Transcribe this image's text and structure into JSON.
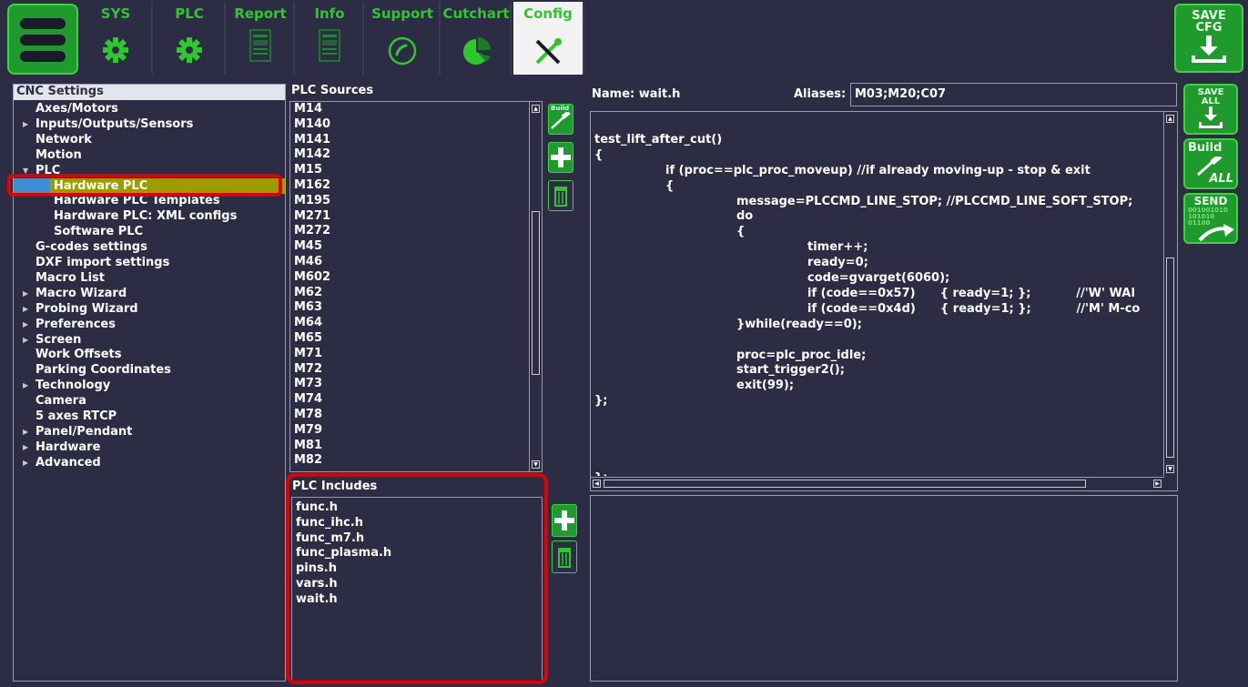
{
  "toolbar": {
    "tabs": [
      {
        "label": "SYS",
        "icon": "gear-icon"
      },
      {
        "label": "PLC",
        "icon": "gear-icon"
      },
      {
        "label": "Report",
        "icon": "report-icon"
      },
      {
        "label": "Info",
        "icon": "info-icon"
      },
      {
        "label": "Support",
        "icon": "phone-icon"
      },
      {
        "label": "Cutchart",
        "icon": "pie-chart-icon"
      },
      {
        "label": "Config",
        "icon": "tools-icon"
      }
    ],
    "active_tab": "Config",
    "save_cfg": [
      "SAVE",
      "CFG"
    ]
  },
  "right_buttons": {
    "save_all": [
      "SAVE",
      "ALL"
    ],
    "build_all": [
      "Build",
      "ALL"
    ],
    "send": "SEND",
    "send_digits": [
      "001001010",
      "101010",
      "01100"
    ]
  },
  "settings_tree": {
    "header": "CNC Settings",
    "items": [
      {
        "label": "Axes/Motors",
        "indent": 1,
        "arrow": ""
      },
      {
        "label": "Inputs/Outputs/Sensors",
        "indent": 1,
        "arrow": "right"
      },
      {
        "label": "Network",
        "indent": 1,
        "arrow": ""
      },
      {
        "label": "Motion",
        "indent": 1,
        "arrow": ""
      },
      {
        "label": "PLC",
        "indent": 1,
        "arrow": "down"
      },
      {
        "label": "Hardware PLC",
        "indent": 2,
        "arrow": "",
        "selected": true
      },
      {
        "label": "Hardware PLC Templates",
        "indent": 2,
        "arrow": ""
      },
      {
        "label": "Hardware PLC: XML configs",
        "indent": 2,
        "arrow": ""
      },
      {
        "label": "Software PLC",
        "indent": 2,
        "arrow": ""
      },
      {
        "label": "G-codes settings",
        "indent": 1,
        "arrow": ""
      },
      {
        "label": "DXF import settings",
        "indent": 1,
        "arrow": ""
      },
      {
        "label": "Macro List",
        "indent": 1,
        "arrow": ""
      },
      {
        "label": "Macro Wizard",
        "indent": 1,
        "arrow": "right"
      },
      {
        "label": "Probing Wizard",
        "indent": 1,
        "arrow": "right"
      },
      {
        "label": "Preferences",
        "indent": 1,
        "arrow": "right"
      },
      {
        "label": "Screen",
        "indent": 1,
        "arrow": "right"
      },
      {
        "label": "Work Offsets",
        "indent": 1,
        "arrow": ""
      },
      {
        "label": "Parking Coordinates",
        "indent": 1,
        "arrow": ""
      },
      {
        "label": "Technology",
        "indent": 1,
        "arrow": "right"
      },
      {
        "label": "Camera",
        "indent": 1,
        "arrow": ""
      },
      {
        "label": "5 axes RTCP",
        "indent": 1,
        "arrow": ""
      },
      {
        "label": "Panel/Pendant",
        "indent": 1,
        "arrow": "right"
      },
      {
        "label": "Hardware",
        "indent": 1,
        "arrow": "right"
      },
      {
        "label": "Advanced",
        "indent": 1,
        "arrow": "right"
      }
    ]
  },
  "plc_sources": {
    "header": "PLC Sources",
    "build_label": "Build",
    "items": [
      "M14",
      "M140",
      "M141",
      "M142",
      "M15",
      "M162",
      "M195",
      "M271",
      "M272",
      "M45",
      "M46",
      "M602",
      "M62",
      "M63",
      "M64",
      "M65",
      "M71",
      "M72",
      "M73",
      "M74",
      "M78",
      "M79",
      "M81",
      "M82"
    ]
  },
  "plc_includes": {
    "header": "PLC Includes",
    "items": [
      "func.h",
      "func_ihc.h",
      "func_m7.h",
      "func_plasma.h",
      "pins.h",
      "vars.h",
      "wait.h"
    ]
  },
  "editor": {
    "name_label": "Name: wait.h",
    "aliases_label": "Aliases:",
    "aliases_value": "M03;M20;C07",
    "lines": [
      {
        "t": "",
        "i": 0
      },
      {
        "t": "test_lift_after_cut()",
        "i": 0
      },
      {
        "t": "{",
        "i": 0
      },
      {
        "t": "if (proc==plc_proc_moveup) //if already moving-up - stop & exit",
        "i": 1
      },
      {
        "t": "{",
        "i": 1
      },
      {
        "t": "message=PLCCMD_LINE_STOP; //PLCCMD_LINE_SOFT_STOP;",
        "i": 2
      },
      {
        "t": "do",
        "i": 2
      },
      {
        "t": "{",
        "i": 2
      },
      {
        "t": "timer++;",
        "i": 3
      },
      {
        "t": "ready=0;",
        "i": 3
      },
      {
        "t": "code=gvarget(6060);",
        "i": 3
      },
      {
        "t": "if (code==0x57)      { ready=1; };           //'W' WAI",
        "i": 3
      },
      {
        "t": "if (code==0x4d)      { ready=1; };           //'M' M-co",
        "i": 3
      },
      {
        "t": "}while(ready==0);",
        "i": 2
      },
      {
        "t": "",
        "i": 0
      },
      {
        "t": "proc=plc_proc_idle;",
        "i": 2
      },
      {
        "t": "start_trigger2();",
        "i": 2
      },
      {
        "t": "exit(99);",
        "i": 2
      },
      {
        "t": "};",
        "i": 0
      },
      {
        "t": "",
        "i": 0
      },
      {
        "t": "",
        "i": 0
      },
      {
        "t": "",
        "i": 0
      },
      {
        "t": "",
        "i": 0
      },
      {
        "t": "};",
        "i": 0
      }
    ]
  },
  "colors": {
    "background": "#2c2c44",
    "accent_green": "#2ec82e",
    "selection": "#9c9c00",
    "highlight_box": "#e00000"
  }
}
